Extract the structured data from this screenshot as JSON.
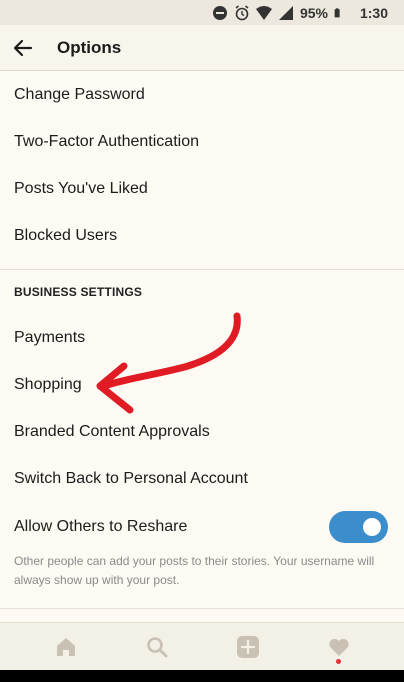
{
  "status_bar": {
    "battery": "95%",
    "time": "1:30",
    "icons": [
      "vibrate-icon",
      "do-not-disturb-icon",
      "alarm-icon",
      "wifi-icon",
      "signal-icon",
      "battery-icon"
    ]
  },
  "header": {
    "title": "Options",
    "back_icon": "arrow-left-icon"
  },
  "account_items": [
    {
      "label": "Change Password"
    },
    {
      "label": "Two-Factor Authentication"
    },
    {
      "label": "Posts You've Liked"
    },
    {
      "label": "Blocked Users"
    }
  ],
  "business": {
    "header": "BUSINESS SETTINGS",
    "items": [
      {
        "label": "Payments"
      },
      {
        "label": "Shopping"
      },
      {
        "label": "Branded Content Approvals"
      },
      {
        "label": "Switch Back to Personal Account"
      }
    ],
    "reshare": {
      "label": "Allow Others to Reshare",
      "enabled": true,
      "help": "Other people can add your posts to their stories. Your username will always show up with your post."
    }
  },
  "tab_bar": {
    "tabs": [
      "home-icon",
      "search-icon",
      "add-post-icon",
      "activity-heart-icon"
    ],
    "notification_dot_color": "#e0303a"
  },
  "colors": {
    "toggle_on": "#3b8ecb",
    "annotation_arrow": "#e01b24",
    "background": "#fcfaf3"
  }
}
